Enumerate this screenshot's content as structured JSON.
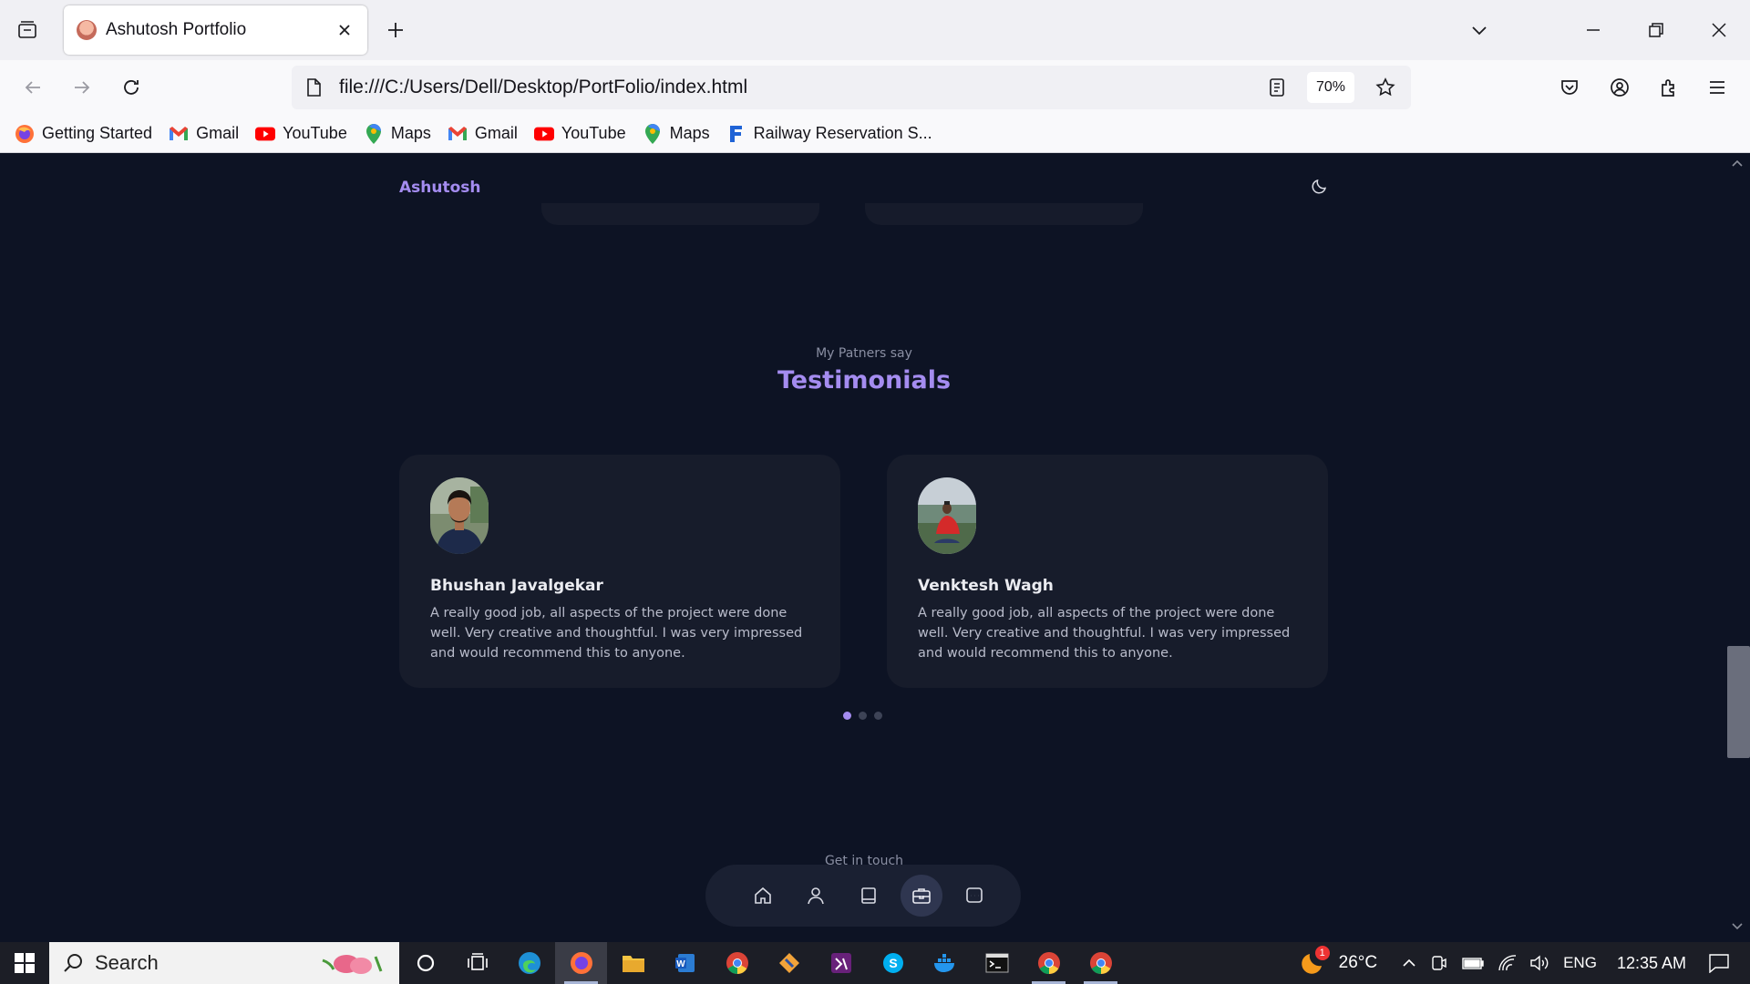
{
  "browser": {
    "tab_title": "Ashutosh Portfolio",
    "url": "file:///C:/Users/Dell/Desktop/PortFolio/index.html",
    "zoom": "70%",
    "bookmarks": [
      {
        "label": "Getting Started",
        "icon": "firefox-icon"
      },
      {
        "label": "Gmail",
        "icon": "gmail-icon"
      },
      {
        "label": "YouTube",
        "icon": "youtube-icon"
      },
      {
        "label": "Maps",
        "icon": "maps-icon"
      },
      {
        "label": "Gmail",
        "icon": "gmail-icon"
      },
      {
        "label": "YouTube",
        "icon": "youtube-icon"
      },
      {
        "label": "Maps",
        "icon": "maps-icon"
      },
      {
        "label": "Railway Reservation S...",
        "icon": "railway-icon"
      }
    ]
  },
  "site": {
    "brand": "Ashutosh",
    "testimonials": {
      "subtitle": "My Patners say",
      "title": "Testimonials",
      "cards": [
        {
          "name": "Bhushan Javalgekar",
          "text": "A really good job, all aspects of the project were done well. Very creative and thoughtful. I was very impressed and would recommend this to anyone."
        },
        {
          "name": "Venktesh Wagh",
          "text": "A really good job, all aspects of the project were done well. Very creative and thoughtful. I was very impressed and would recommend this to anyone."
        }
      ],
      "pagination": {
        "total": 3,
        "active": 1
      }
    },
    "contact_subtitle": "Get in touch",
    "dock": [
      {
        "icon": "home-icon",
        "active": false
      },
      {
        "icon": "user-icon",
        "active": false
      },
      {
        "icon": "document-icon",
        "active": false
      },
      {
        "icon": "briefcase-icon",
        "active": true
      },
      {
        "icon": "message-icon",
        "active": false
      }
    ]
  },
  "taskbar": {
    "search_label": "Search",
    "weather": "26°C",
    "weather_badge": "1",
    "language": "ENG",
    "time": "12:35 AM"
  },
  "colors": {
    "accent": "#a48cf0",
    "page_bg": "#0d1324",
    "card_bg": "#171c2b"
  }
}
